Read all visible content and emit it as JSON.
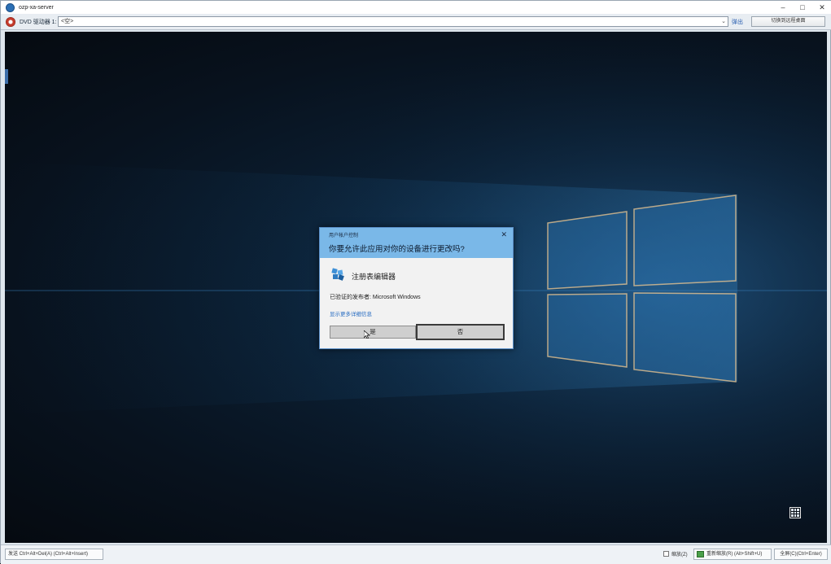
{
  "window": {
    "title": "ozp-xa-server",
    "controls": {
      "minimize": "–",
      "maximize": "□",
      "close": "✕"
    }
  },
  "toolbar": {
    "dvd_label": "DVD 驱动器 1:",
    "dvd_value": "<空>",
    "eject_label": "弹出",
    "switch_label": "切换到远程桌面"
  },
  "uac": {
    "caption": "用户帐户控制",
    "question": "你要允许此应用对你的设备进行更改吗?",
    "app_name": "注册表编辑器",
    "publisher": "已验证的发布者: Microsoft Windows",
    "more_info": "显示更多详细信息",
    "yes": "是",
    "no": "否",
    "close": "✕"
  },
  "statusbar": {
    "send_cad": "发送 Ctrl+Alt+Del(A) (Ctrl+Alt+Insert)",
    "zoom_label": "缩放(Z)",
    "reconnect_label": "重新缩放(R) (Alt+Shift+U)",
    "fullscreen_label": "全屏(C)(Ctrl+Enter)"
  },
  "icons": {
    "app": "vm-console-icon",
    "dvd": "dvd-drive-icon",
    "regedit": "registry-editor-icon",
    "tray": "keyboard-layout-icon"
  },
  "colors": {
    "uac_header": "#7ab8e8",
    "link": "#2a6ec2",
    "desktop": "#0b1f33"
  }
}
